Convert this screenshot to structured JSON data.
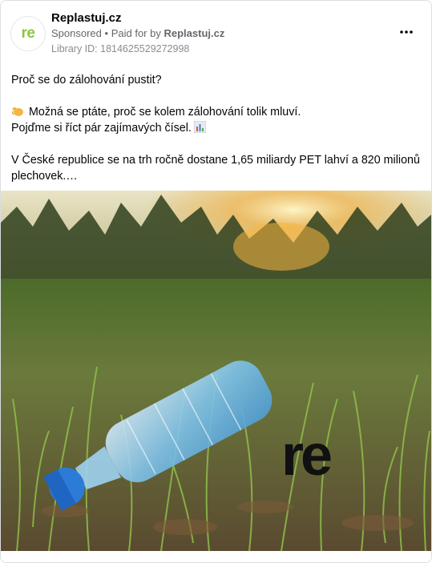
{
  "ad": {
    "page_name": "Replastuj.cz",
    "avatar_text": "re",
    "sponsored_label": "Sponsored",
    "separator": "•",
    "paid_for_prefix": "Paid for by",
    "paid_for_name": "Replastuj.cz",
    "library_id": "Library ID: 1814625529272998",
    "more_icon": "more-dots-icon"
  },
  "post": {
    "line1": "Proč se do zálohování pustit?",
    "line2": "Možná se ptáte, proč se kolem zálohování tolik mluví.",
    "line3": "Pojďme si říct pár zajímavých čísel.",
    "line4": "V České republice se na trh ročně dostane 1,65 miliardy PET lahví a 820 milionů plechovek.…",
    "emoji_1": "waving-hand-icon",
    "emoji_2": "bar-chart-icon"
  },
  "image": {
    "description_icon": "plastic-bottle-in-grass-photo",
    "logo_text": "re"
  },
  "colors": {
    "brand_green": "#8cc63f",
    "secondary_text": "#65676b",
    "border": "#dadde1"
  }
}
